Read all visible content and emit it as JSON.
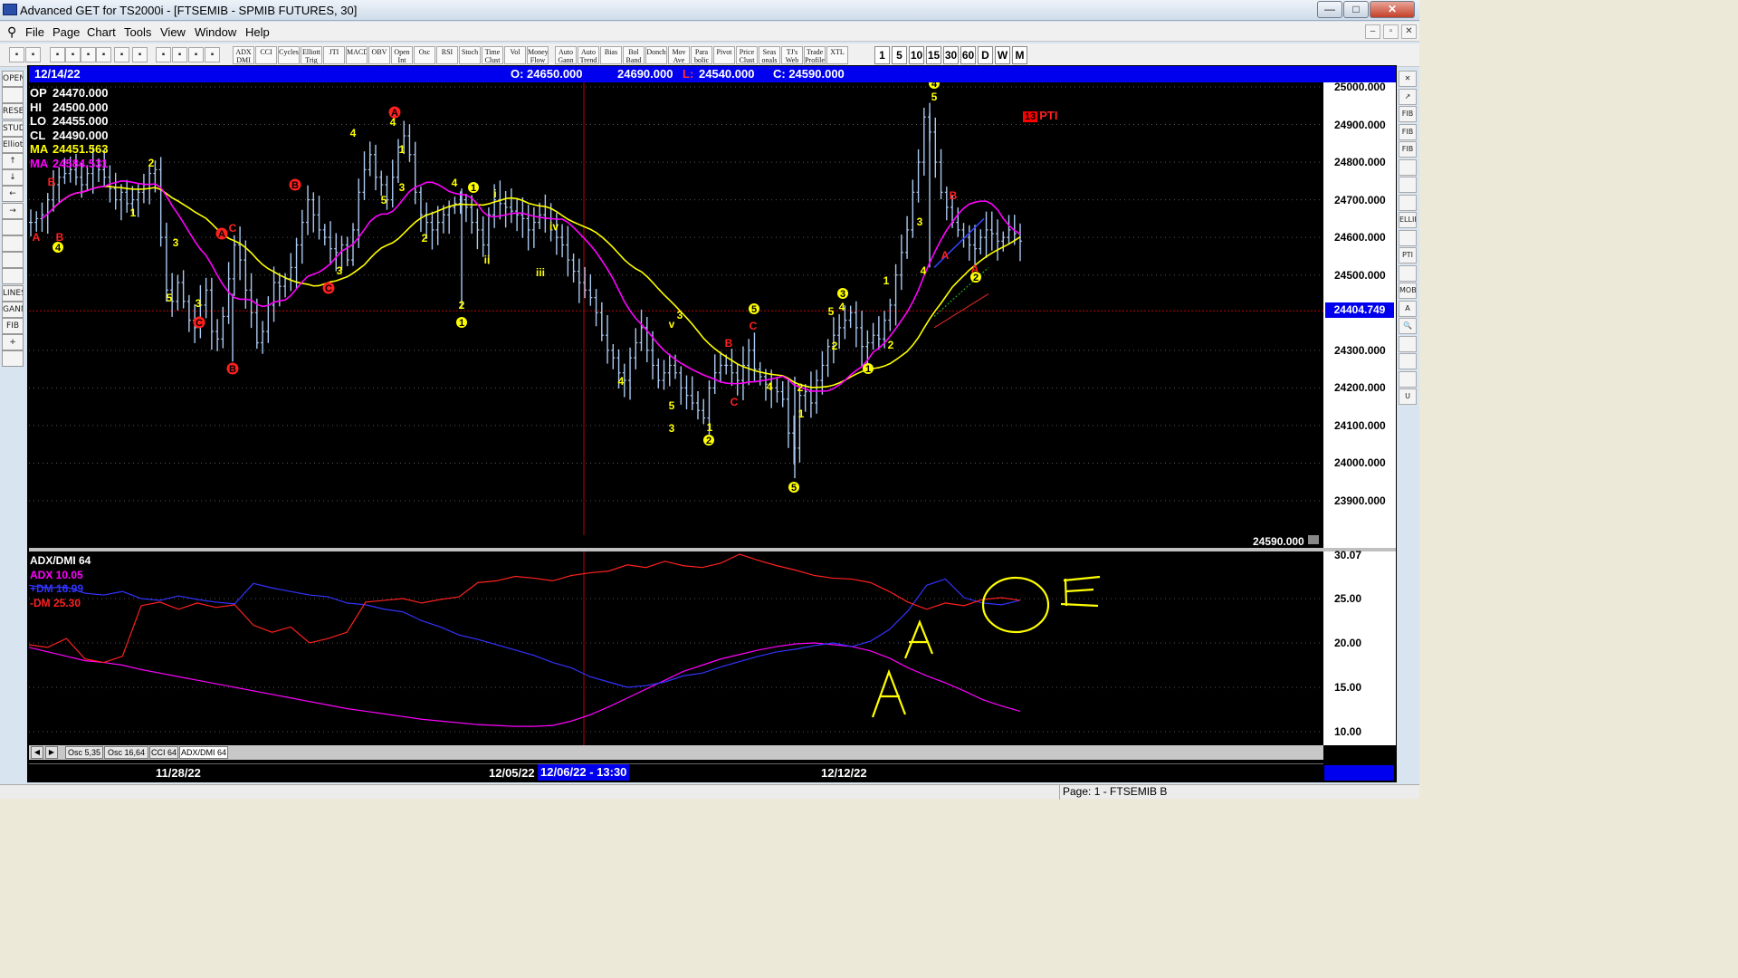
{
  "window": {
    "title": "Advanced GET for TS2000i - [FTSEMIB - SPMIB FUTURES, 30]"
  },
  "menu": [
    "File",
    "Page",
    "Chart",
    "Tools",
    "View",
    "Window",
    "Help"
  ],
  "toolbar": {
    "study_buttons": [
      "ADX DMI",
      "CCI",
      "Cycles",
      "Elliott Trig",
      "JTI",
      "MACD",
      "OBV",
      "Open Int",
      "Osc",
      "RSI",
      "Stoch",
      "Time Clust",
      "Vol",
      "Money Flow",
      "Auto Gann",
      "Auto Trend",
      "Bias",
      "Bol Band",
      "Donch",
      "Mov Ave",
      "Para bolic",
      "Pivot",
      "Price Clust",
      "Seas onals",
      "TJ's Web",
      "Trade Profile",
      "XTL"
    ],
    "timeframes": [
      "1",
      "5",
      "10",
      "15",
      "30",
      "60",
      "D",
      "W",
      "M"
    ]
  },
  "left_tools": [
    "OPEN",
    "",
    "RESET",
    "STUDY",
    "Elliott",
    "↑",
    "↓",
    "←",
    "→",
    "",
    "",
    "",
    "",
    "LINES",
    "GANN",
    "FIB",
    "+",
    ""
  ],
  "right_tools": [
    "✕",
    "↗",
    "FIB RET",
    "FIB EXT",
    "FIB TIME",
    "",
    "",
    "",
    "ELLIPS",
    "",
    "PTI",
    "",
    "MOB",
    "A",
    "🔍",
    "",
    "",
    "",
    "U"
  ],
  "infobar": {
    "date": "12/14/22",
    "open": "O: 24650.000",
    "high": "24690.000",
    "low_prefix": "L:",
    "low": "24540.000",
    "close": "C: 24590.000"
  },
  "ohlc_legend": [
    {
      "label": "OP",
      "value": "24470.000",
      "color": "#ffffff"
    },
    {
      "label": "HI",
      "value": "24500.000",
      "color": "#ffffff"
    },
    {
      "label": "LO",
      "value": "24455.000",
      "color": "#ffffff"
    },
    {
      "label": "CL",
      "value": "24490.000",
      "color": "#ffffff"
    },
    {
      "label": "MA",
      "value": "24451.563",
      "color": "#ffff00"
    },
    {
      "label": "MA",
      "value": "24584.531",
      "color": "#ff00ff"
    }
  ],
  "indicator_legend": [
    {
      "text": "ADX/DMI 64",
      "color": "#ffffff"
    },
    {
      "text": "ADX 10.05",
      "color": "#ff00ff"
    },
    {
      "text": "+DM 16.99",
      "color": "#3333ff"
    },
    {
      "text": "-DM 25.30",
      "color": "#ff2020"
    }
  ],
  "price_axis_labels": [
    "25000.000",
    "24900.000",
    "24800.000",
    "24700.000",
    "24600.000",
    "24500.000",
    "24300.000",
    "24200.000",
    "24100.000",
    "24000.000",
    "23900.000"
  ],
  "price_tag": "24404.749",
  "last_close": "24590.000",
  "indicator_axis_labels": [
    "30.07",
    "25.00",
    "20.00",
    "15.00",
    "10.00"
  ],
  "pti": {
    "count": "13",
    "label": "PTI"
  },
  "tabs": [
    "Osc 5,35",
    "Osc 16,64",
    "CCI 64",
    "ADX/DMI 64"
  ],
  "dates": {
    "d1": "11/28/22",
    "d2": "12/05/22",
    "cursor": "12/06/22 - 13:30",
    "d3": "12/12/22"
  },
  "status": {
    "page": "Page: 1 - FTSEMIB B"
  },
  "colors": {
    "infobar": "#0000ee",
    "wave_yellow": "#ffff00",
    "wave_red": "#ff2020",
    "ma_fast": "#ffff00",
    "ma_slow": "#ff00ff",
    "adx": "#ff00ff",
    "plus_dm": "#3333ff",
    "minus_dm": "#ff2020",
    "bars": "#aac8f0"
  },
  "chart_data": {
    "type": "ohlc",
    "ylim": [
      23850,
      25000
    ],
    "closes": [
      24640,
      24650,
      24660,
      24700,
      24740,
      24760,
      24770,
      24780,
      24760,
      24740,
      24770,
      24790,
      24780,
      24760,
      24730,
      24700,
      24720,
      24690,
      24700,
      24720,
      24740,
      24770,
      24780,
      24600,
      24460,
      24430,
      24480,
      24430,
      24380,
      24360,
      24420,
      24460,
      24350,
      24330,
      24390,
      24490,
      24580,
      24540,
      24460,
      24400,
      24320,
      24350,
      24420,
      24480,
      24470,
      24490,
      24520,
      24580,
      24640,
      24700,
      24660,
      24620,
      24600,
      24570,
      24560,
      24580,
      24540,
      24620,
      24720,
      24780,
      24820,
      24760,
      24740,
      24700,
      24760,
      24840,
      24870,
      24820,
      24720,
      24660,
      24640,
      24620,
      24640,
      24660,
      24680,
      24690,
      24700,
      24680,
      24640,
      24620,
      24580,
      24660,
      24700,
      24690,
      24680,
      24670,
      24660,
      24650,
      24620,
      24640,
      24660,
      24650,
      24620,
      24600,
      24580,
      24540,
      24510,
      24480,
      24460,
      24440,
      24400,
      24340,
      24300,
      24280,
      24240,
      24220,
      24280,
      24320,
      24360,
      24300,
      24260,
      24220,
      24240,
      24260,
      24240,
      24200,
      24180,
      24160,
      24140,
      24120,
      24200,
      24240,
      24260,
      24260,
      24240,
      24220,
      24260,
      24300,
      24250,
      24230,
      24210,
      24200,
      24190,
      24170,
      24080,
      24040,
      24180,
      24190,
      24160,
      24220,
      24260,
      24310,
      24340,
      24360,
      24380,
      24400,
      24360,
      24310,
      24320,
      24340,
      24330,
      24380,
      24420,
      24500,
      24560,
      24620,
      24720,
      24800,
      24920,
      24880,
      24800,
      24720,
      24680,
      24640,
      24620,
      24600,
      24580,
      24570,
      24600,
      24620,
      24610,
      24590,
      24600,
      24620,
      24610,
      24590
    ],
    "ma_fast_label": "MA 24451.563",
    "ma_slow_label": "MA 24584.531",
    "wave_labels_yellow": [
      "4",
      "1",
      "2",
      "3",
      "5",
      "3",
      "4",
      "5",
      "3",
      "4",
      "1",
      "2",
      "3",
      "1",
      "2",
      "4",
      "1",
      "i",
      "ii",
      "iii",
      "iv",
      "4",
      "v",
      "3",
      "5",
      "3",
      "1",
      "2",
      "5",
      "3",
      "4",
      "5",
      "2",
      "1",
      "2",
      "1",
      "3",
      "4",
      "5",
      "4",
      "1",
      "5",
      "2",
      "2",
      "4"
    ],
    "wave_labels_red": [
      "A",
      "B",
      "C",
      "A",
      "B",
      "B",
      "C",
      "A",
      "B",
      "C",
      "C",
      "A",
      "B",
      "A",
      "B",
      "C"
    ],
    "series": [
      {
        "name": "ADX",
        "values": [
          19.5,
          19.0,
          18.5,
          18.0,
          17.8,
          17.5,
          17.0,
          16.6,
          16.2,
          15.8,
          15.4,
          15.0,
          14.6,
          14.2,
          13.8,
          13.4,
          13.0,
          12.6,
          12.3,
          12.0,
          11.7,
          11.4,
          11.2,
          11.0,
          10.8,
          10.7,
          10.6,
          10.6,
          10.7,
          11.2,
          11.9,
          12.8,
          13.8,
          14.8,
          15.8,
          16.8,
          17.5,
          18.2,
          18.7,
          19.2,
          19.6,
          19.9,
          20.0,
          19.8,
          19.6,
          19.1,
          18.3,
          17.2,
          16.3,
          15.5,
          14.6,
          13.6,
          12.9,
          12.3
        ]
      },
      {
        "name": "+DM",
        "values": [
          26.5,
          26.2,
          26.3,
          25.6,
          25.4,
          25.8,
          25.0,
          24.8,
          25.3,
          24.9,
          24.6,
          24.4,
          26.7,
          26.2,
          25.8,
          25.4,
          25.2,
          24.5,
          24.3,
          23.8,
          23.5,
          22.5,
          21.8,
          20.9,
          20.4,
          19.8,
          19.2,
          18.6,
          17.8,
          17.2,
          16.2,
          15.6,
          15.0,
          15.2,
          15.6,
          16.3,
          16.6,
          17.3,
          17.9,
          18.5,
          19.0,
          19.3,
          19.7,
          20.0,
          19.6,
          20.2,
          21.5,
          23.6,
          26.5,
          27.2,
          25.1,
          24.5,
          24.3,
          24.8
        ]
      },
      {
        "name": "-DM",
        "values": [
          19.8,
          19.5,
          20.5,
          18.2,
          17.8,
          18.5,
          24.2,
          24.6,
          23.8,
          24.5,
          24.0,
          24.3,
          22.0,
          21.2,
          21.8,
          20.0,
          20.5,
          21.2,
          24.6,
          24.8,
          25.0,
          24.5,
          24.9,
          25.2,
          26.8,
          27.0,
          27.5,
          27.3,
          27.0,
          27.6,
          27.9,
          28.1,
          28.8,
          28.5,
          29.2,
          28.7,
          28.5,
          29.0,
          30.0,
          29.3,
          28.7,
          28.2,
          27.6,
          27.3,
          27.2,
          26.8,
          25.8,
          24.6,
          23.8,
          24.5,
          24.2,
          24.9,
          25.1,
          24.8
        ]
      }
    ]
  }
}
